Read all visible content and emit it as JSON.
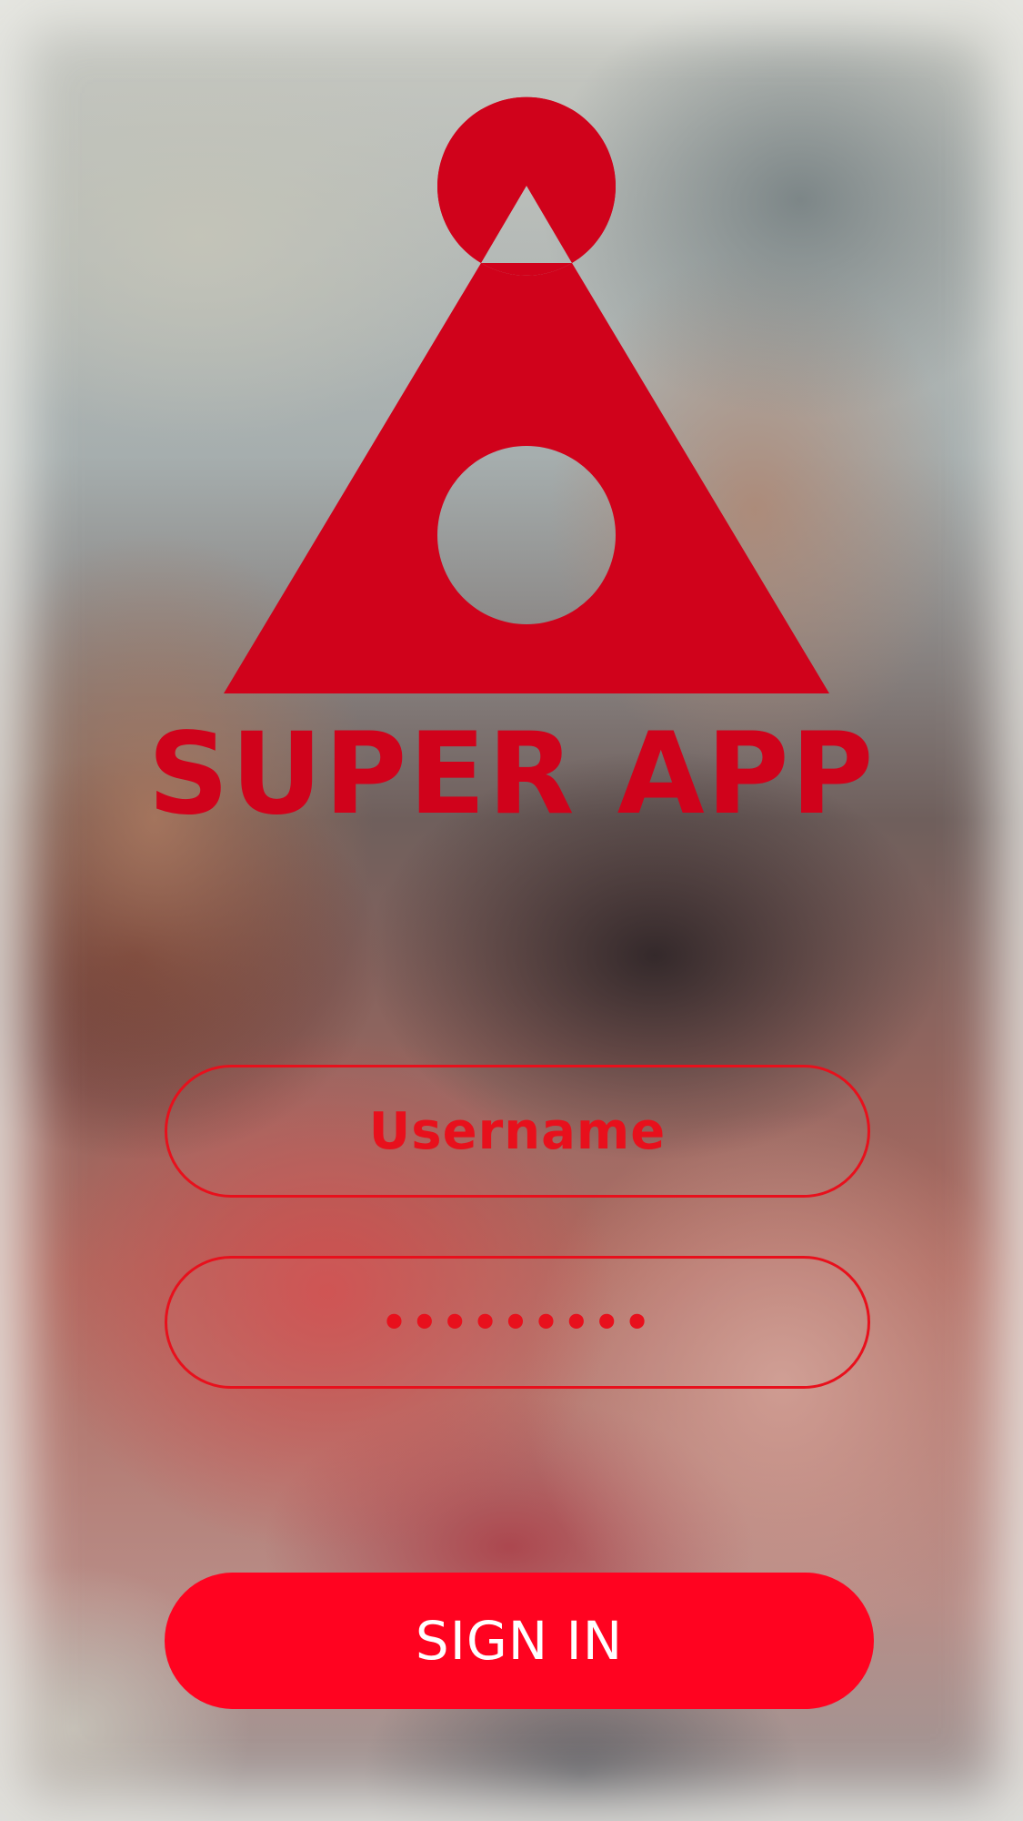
{
  "app": {
    "brand_name": "SUPER APP",
    "logo_icon": "super-app-logo-icon",
    "accent_color": "#d0021b",
    "button_color": "#ff0320"
  },
  "form": {
    "username": {
      "placeholder": "Username",
      "value": ""
    },
    "password": {
      "value": "•••••••••"
    },
    "submit_label": "SIGN IN"
  }
}
